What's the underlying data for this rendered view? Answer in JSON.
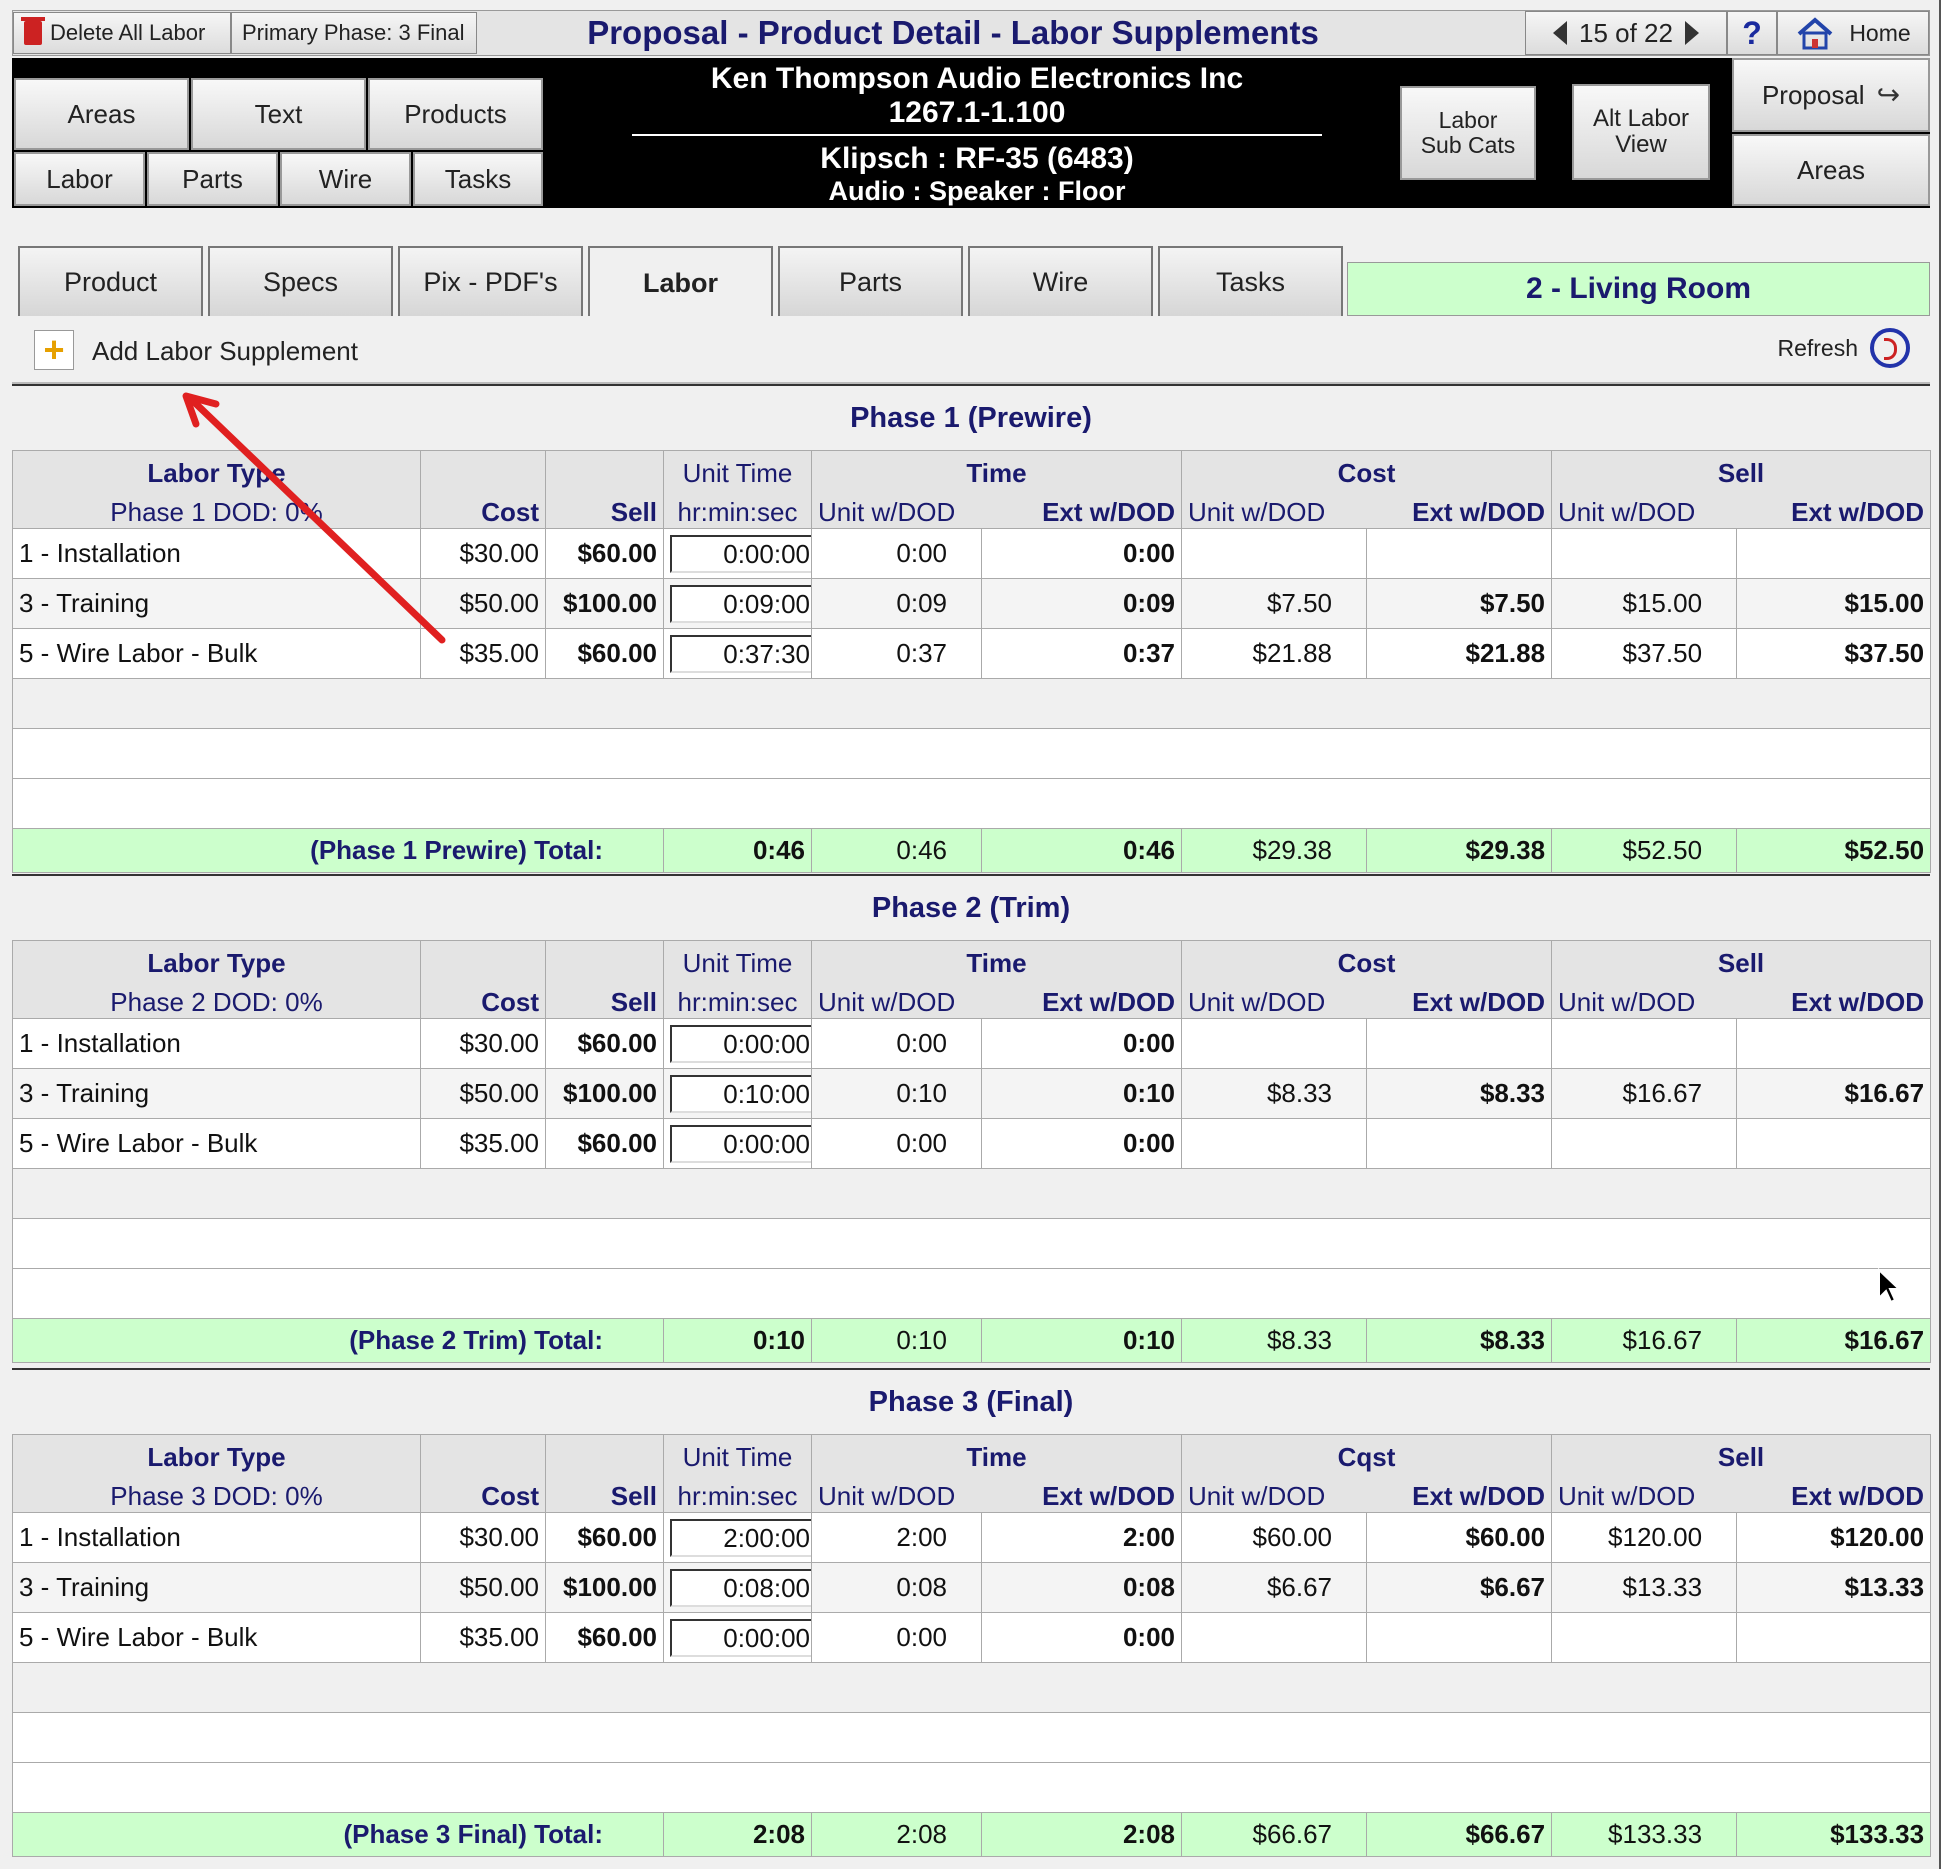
{
  "toolbar": {
    "delete_all_labor": "Delete All Labor",
    "primary_phase": "Primary Phase: 3 Final",
    "title": "Proposal - Product Detail - Labor Supplements",
    "record_position": "15 of 22",
    "help": "?",
    "home": "Home"
  },
  "nav_buttons": {
    "areas": "Areas",
    "text": "Text",
    "products": "Products",
    "labor": "Labor",
    "parts": "Parts",
    "wire": "Wire",
    "tasks": "Tasks",
    "labor_sub_cats": "Labor\nSub Cats",
    "alt_labor_view": "Alt Labor\nView",
    "proposal": "Proposal",
    "areas_right": "Areas"
  },
  "header": {
    "company": "Ken Thompson  Audio Electronics Inc",
    "proposal_number": "1267.1-1.100",
    "product": "Klipsch : RF-35 (6483)",
    "category": "Audio : Speaker : Floor"
  },
  "tabs": [
    "Product",
    "Specs",
    "Pix - PDF's",
    "Labor",
    "Parts",
    "Wire",
    "Tasks"
  ],
  "active_tab": "Labor",
  "room": "2 - Living Room",
  "actions": {
    "add_label": "Add Labor Supplement",
    "refresh_label": "Refresh"
  },
  "column_headers": {
    "labor_type": "Labor Type",
    "cost": "Cost",
    "sell": "Sell",
    "unit_time": "Unit Time",
    "unit_time_fmt": "hr:min:sec",
    "time": "Time",
    "cost_group": "Cost",
    "sell_group": "Sell",
    "unit_wdod": "Unit w/DOD",
    "ext_wdod": "Ext w/DOD"
  },
  "phases": [
    {
      "title": "Phase 1 (Prewire)",
      "dod": "Phase 1 DOD: 0%",
      "cost_group_label": "Cost",
      "rows": [
        {
          "type": "1 - Installation",
          "cost": "$30.00",
          "sell": "$60.00",
          "unit_time": "0:00:00",
          "time_unit": "0:00",
          "time_ext": "0:00",
          "cost_unit": "",
          "cost_ext": "",
          "sell_unit": "",
          "sell_ext": ""
        },
        {
          "type": "3 - Training",
          "cost": "$50.00",
          "sell": "$100.00",
          "unit_time": "0:09:00",
          "time_unit": "0:09",
          "time_ext": "0:09",
          "cost_unit": "$7.50",
          "cost_ext": "$7.50",
          "sell_unit": "$15.00",
          "sell_ext": "$15.00"
        },
        {
          "type": "5 - Wire Labor - Bulk",
          "cost": "$35.00",
          "sell": "$60.00",
          "unit_time": "0:37:30",
          "time_unit": "0:37",
          "time_ext": "0:37",
          "cost_unit": "$21.88",
          "cost_ext": "$21.88",
          "sell_unit": "$37.50",
          "sell_ext": "$37.50"
        }
      ],
      "total": {
        "label": "(Phase 1 Prewire) Total:",
        "unit_time": "0:46",
        "time_unit": "0:46",
        "time_ext": "0:46",
        "cost_unit": "$29.38",
        "cost_ext": "$29.38",
        "sell_unit": "$52.50",
        "sell_ext": "$52.50"
      }
    },
    {
      "title": "Phase 2 (Trim)",
      "dod": "Phase 2 DOD: 0%",
      "cost_group_label": "Cost",
      "rows": [
        {
          "type": "1 - Installation",
          "cost": "$30.00",
          "sell": "$60.00",
          "unit_time": "0:00:00",
          "time_unit": "0:00",
          "time_ext": "0:00",
          "cost_unit": "",
          "cost_ext": "",
          "sell_unit": "",
          "sell_ext": ""
        },
        {
          "type": "3 - Training",
          "cost": "$50.00",
          "sell": "$100.00",
          "unit_time": "0:10:00",
          "time_unit": "0:10",
          "time_ext": "0:10",
          "cost_unit": "$8.33",
          "cost_ext": "$8.33",
          "sell_unit": "$16.67",
          "sell_ext": "$16.67"
        },
        {
          "type": "5 - Wire Labor - Bulk",
          "cost": "$35.00",
          "sell": "$60.00",
          "unit_time": "0:00:00",
          "time_unit": "0:00",
          "time_ext": "0:00",
          "cost_unit": "",
          "cost_ext": "",
          "sell_unit": "",
          "sell_ext": ""
        }
      ],
      "total": {
        "label": "(Phase 2 Trim) Total:",
        "unit_time": "0:10",
        "time_unit": "0:10",
        "time_ext": "0:10",
        "cost_unit": "$8.33",
        "cost_ext": "$8.33",
        "sell_unit": "$16.67",
        "sell_ext": "$16.67"
      }
    },
    {
      "title": "Phase 3 (Final)",
      "dod": "Phase 3 DOD: 0%",
      "cost_group_label": "Cqst",
      "rows": [
        {
          "type": "1 - Installation",
          "cost": "$30.00",
          "sell": "$60.00",
          "unit_time": "2:00:00",
          "time_unit": "2:00",
          "time_ext": "2:00",
          "cost_unit": "$60.00",
          "cost_ext": "$60.00",
          "sell_unit": "$120.00",
          "sell_ext": "$120.00"
        },
        {
          "type": "3 - Training",
          "cost": "$50.00",
          "sell": "$100.00",
          "unit_time": "0:08:00",
          "time_unit": "0:08",
          "time_ext": "0:08",
          "cost_unit": "$6.67",
          "cost_ext": "$6.67",
          "sell_unit": "$13.33",
          "sell_ext": "$13.33"
        },
        {
          "type": "5 - Wire Labor - Bulk",
          "cost": "$35.00",
          "sell": "$60.00",
          "unit_time": "0:00:00",
          "time_unit": "0:00",
          "time_ext": "0:00",
          "cost_unit": "",
          "cost_ext": "",
          "sell_unit": "",
          "sell_ext": ""
        }
      ],
      "total": {
        "label": "(Phase 3 Final) Total:",
        "unit_time": "2:08",
        "time_unit": "2:08",
        "time_ext": "2:08",
        "cost_unit": "$66.67",
        "cost_ext": "$66.67",
        "sell_unit": "$133.33",
        "sell_ext": "$133.33"
      }
    }
  ],
  "colors": {
    "title_blue": "#1a1a6e",
    "total_green": "#ccffcc",
    "annotation_arrow": "#e02020"
  }
}
